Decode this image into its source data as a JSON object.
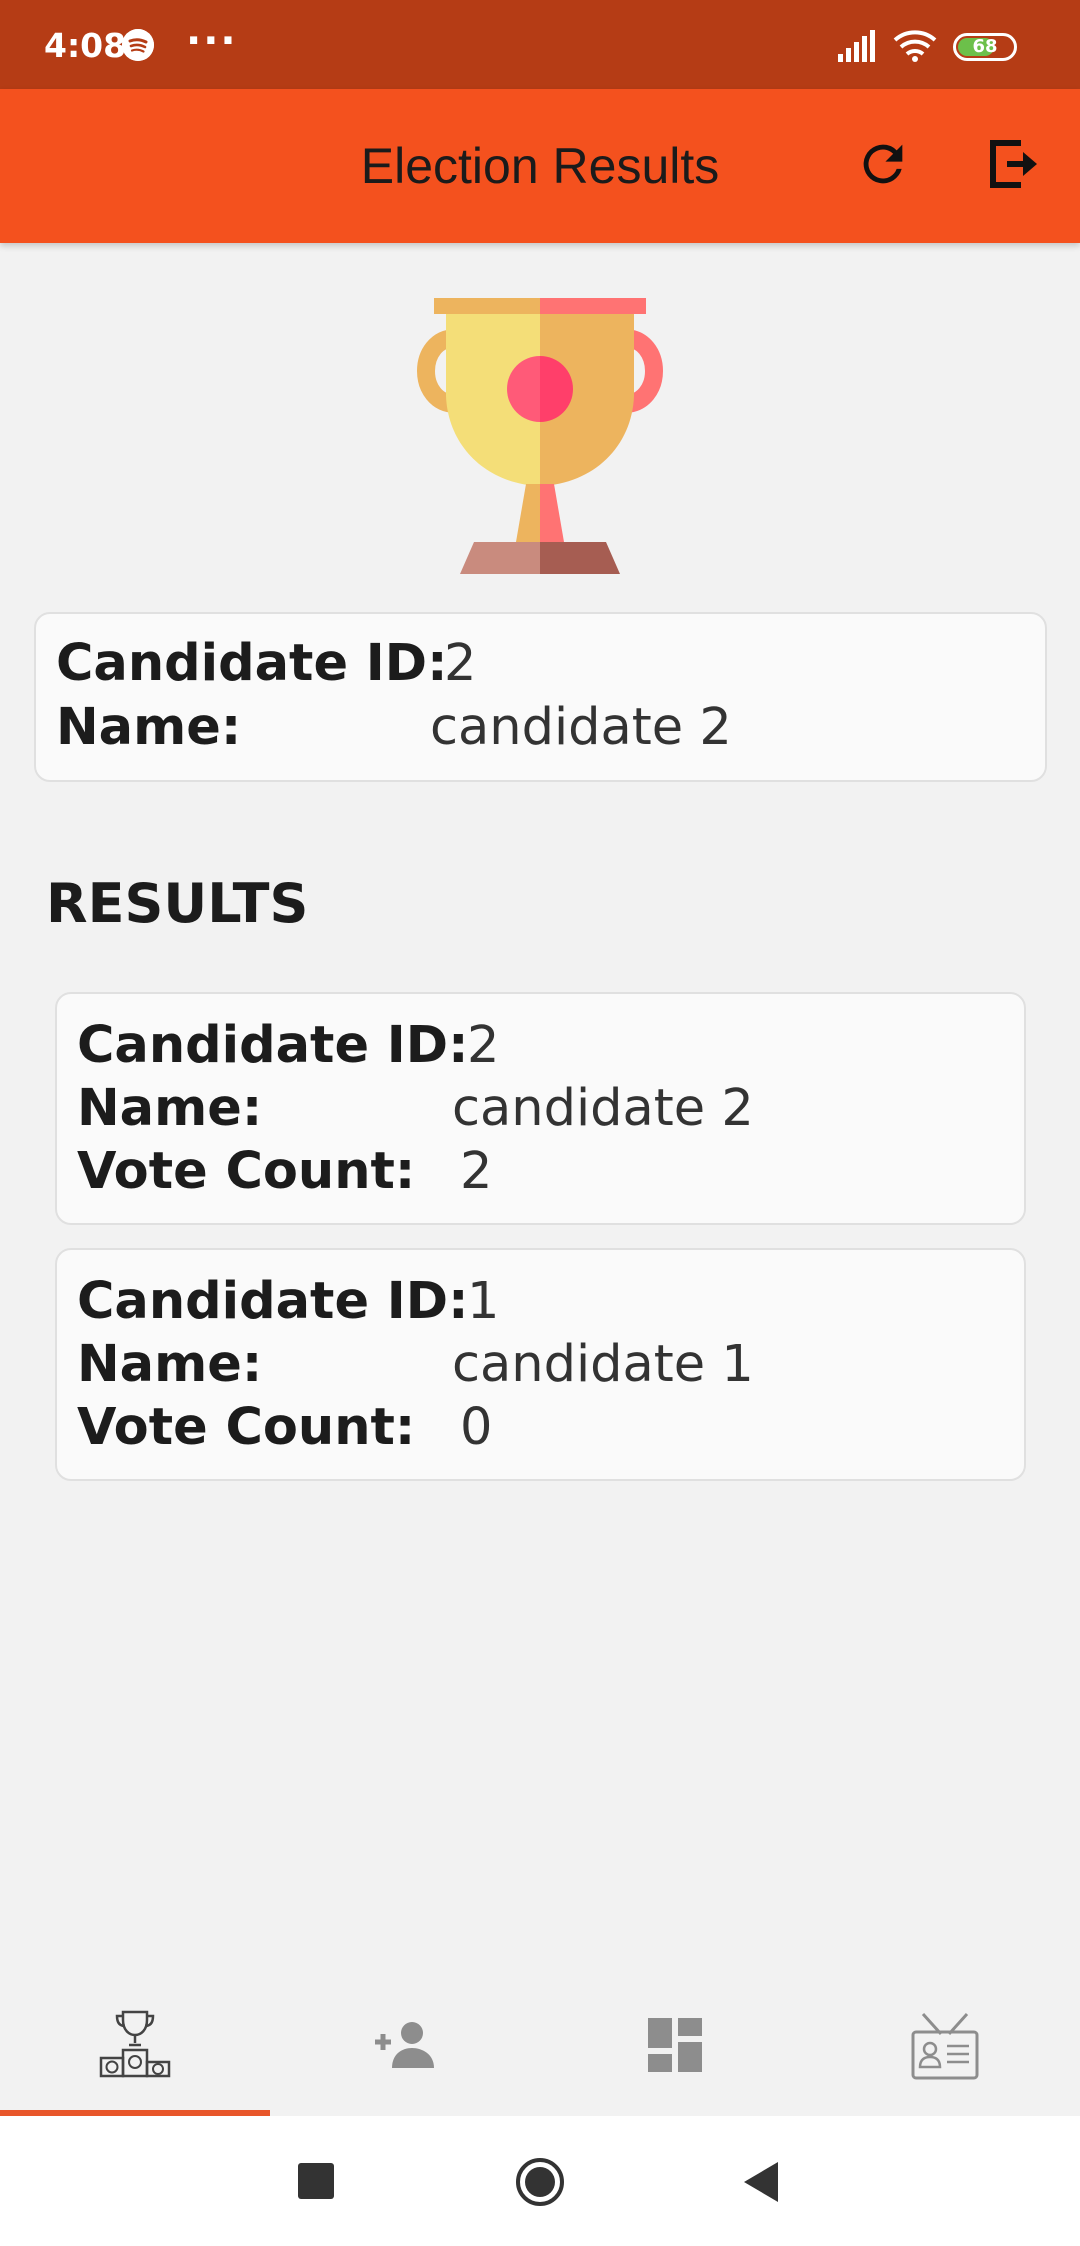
{
  "status_bar": {
    "time": "4:08",
    "more_dots": "···",
    "battery": "68"
  },
  "app_bar": {
    "title": "Election Results"
  },
  "winner": {
    "id_label": "Candidate ID:",
    "id_value": "2",
    "name_label": "Name:",
    "name_value": "candidate 2"
  },
  "results": {
    "heading": "RESULTS",
    "items": [
      {
        "id_label": "Candidate ID:",
        "id_value": "2",
        "name_label": "Name:",
        "name_value": "candidate 2",
        "votes_label": "Vote Count:",
        "votes_value": "2"
      },
      {
        "id_label": "Candidate ID:",
        "id_value": "1",
        "name_label": "Name:",
        "name_value": "candidate 1",
        "votes_label": "Vote Count:",
        "votes_value": "0"
      }
    ]
  },
  "bottom_nav": {
    "tabs": [
      {
        "icon": "podium-trophy-icon",
        "active": true
      },
      {
        "icon": "add-person-icon",
        "active": false
      },
      {
        "icon": "dashboard-icon",
        "active": false
      },
      {
        "icon": "id-badge-icon",
        "active": false
      }
    ]
  },
  "colors": {
    "status_bar": "#b53c15",
    "app_bar": "#f4511e",
    "accent": "#e8562a",
    "background": "#f2f2f2"
  }
}
